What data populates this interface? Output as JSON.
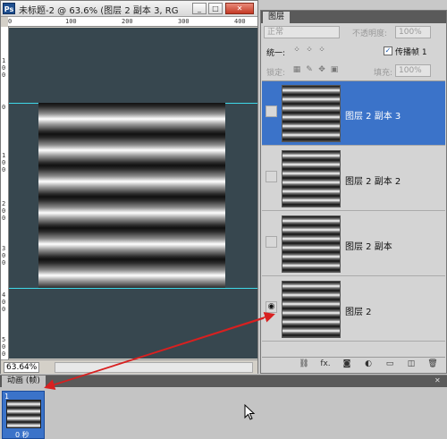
{
  "document": {
    "title": "未标题-2 @ 63.6% (图层 2 副本 3, RG",
    "zoom": "63.64%",
    "ruler_top_ticks": [
      "0",
      "100",
      "200",
      "300",
      "400"
    ],
    "ruler_left_ticks": [
      "1",
      "0",
      "0",
      "0",
      "1",
      "0",
      "0",
      "2",
      "0",
      "0",
      "3",
      "0",
      "0",
      "4",
      "0",
      "0",
      "5",
      "0",
      "0"
    ],
    "min_symbol": "_",
    "max_symbol": "□",
    "close_symbol": "✕"
  },
  "layers_panel": {
    "tab": "图层",
    "blend_mode": "正常",
    "opacity_label": "不透明度:",
    "opacity_value": "100%",
    "unify_label": "统一:",
    "propagate_label": "传播帧 1",
    "propagate_checked": "✓",
    "lock_label": "锁定:",
    "fill_label": "填充:",
    "fill_value": "100%",
    "layers": [
      {
        "name": "图层 2 副本 3",
        "selected": true,
        "visible": false
      },
      {
        "name": "图层 2 副本 2",
        "selected": false,
        "visible": false
      },
      {
        "name": "图层 2 副本",
        "selected": false,
        "visible": false
      },
      {
        "name": "图层 2",
        "selected": false,
        "visible": true
      }
    ],
    "eye_symbol": "◉",
    "footer_icons": [
      "link-icon",
      "fx-icon",
      "mask-icon",
      "adjustment-icon",
      "folder-icon",
      "new-layer-icon",
      "trash-icon"
    ],
    "footer_fx": "fx."
  },
  "animation_panel": {
    "tab": "动画 (帧)",
    "frame_number": "1",
    "frame_delay": "0 秒",
    "close_symbol": "✕"
  },
  "colors": {
    "canvas_bg": "#37474f",
    "selection": "#3b73c9",
    "guide": "#3fd8e8",
    "arrow": "#d82020"
  }
}
